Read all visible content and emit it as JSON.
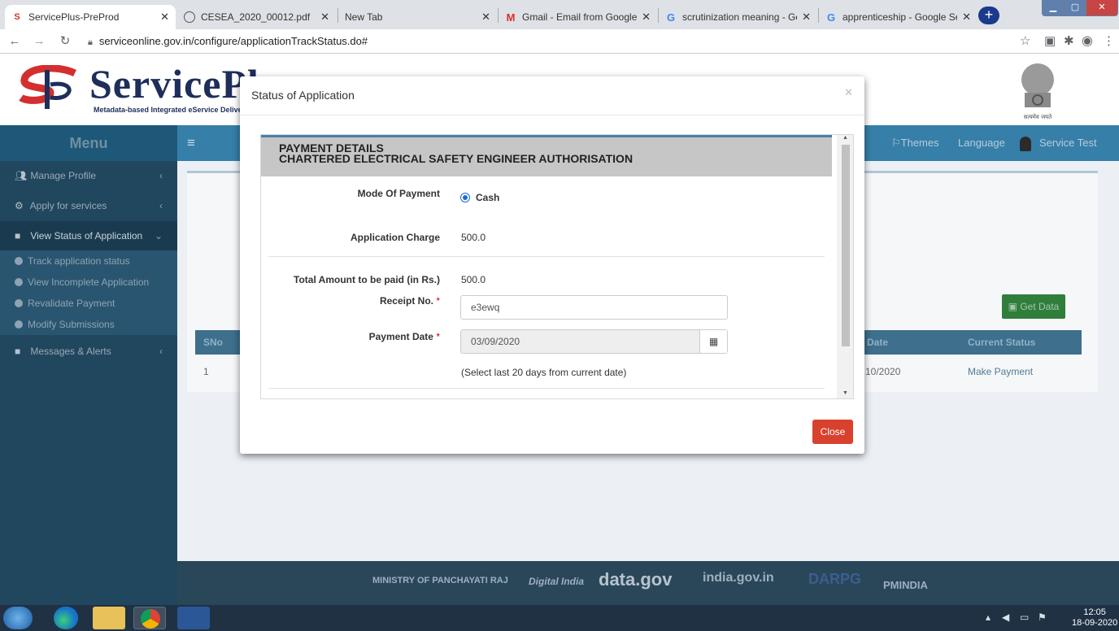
{
  "browser": {
    "tabs": [
      {
        "title": "ServicePlus-PreProd",
        "icon": "serviceplus-favicon"
      },
      {
        "title": "CESEA_2020_00012.pdf",
        "icon": "globe-icon"
      },
      {
        "title": "New Tab",
        "icon": ""
      },
      {
        "title": "Gmail - Email from Google",
        "icon": "gmail-icon"
      },
      {
        "title": "scrutinization meaning - Google",
        "icon": "google-icon"
      },
      {
        "title": "apprenticeship - Google Search",
        "icon": "google-icon"
      }
    ],
    "url": "serviceonline.gov.in/configure/applicationTrackStatus.do#"
  },
  "header": {
    "logo_text": "ServicePlus",
    "logo_sub": "Metadata-based Integrated eService Delivery",
    "emblem_caption": "सत्यमेव जयते"
  },
  "navbar": {
    "menu_label": "Menu",
    "themes_label": "Themes",
    "language_label": "Language",
    "user_label": "Service Test"
  },
  "sidebar": {
    "items": [
      {
        "label": "Manage Profile",
        "icon": "users-icon"
      },
      {
        "label": "Apply for services",
        "icon": "cogs-icon"
      },
      {
        "label": "View Status of Application",
        "icon": "list-icon"
      },
      {
        "label": "Messages & Alerts",
        "icon": "envelope-icon"
      }
    ],
    "subitems": [
      {
        "label": "Track application status"
      },
      {
        "label": "View Incomplete Application"
      },
      {
        "label": "Revalidate Payment"
      },
      {
        "label": "Modify Submissions"
      }
    ]
  },
  "table": {
    "get_data_label": "Get Data",
    "columns": {
      "sno": "SNo",
      "date": "Date",
      "status": "Current Status"
    },
    "rows": [
      {
        "sno": "1",
        "date": "10/2020",
        "status": "Make Payment"
      }
    ]
  },
  "modal": {
    "title": "Status of Application",
    "panel_line1": "PAYMENT DETAILS",
    "panel_line2": "CHARTERED ELECTRICAL SAFETY ENGINEER AUTHORISATION",
    "mode_label": "Mode Of Payment",
    "mode_value": "Cash",
    "charge_label": "Application Charge",
    "charge_value": "500.0",
    "total_label": "Total Amount to be paid (in Rs.)",
    "total_value": "500.0",
    "receipt_label": "Receipt No.",
    "receipt_value": "e3ewq",
    "date_label": "Payment Date",
    "date_value": "03/09/2020",
    "date_hint": "(Select last 20 days from current date)",
    "required_mark": "*",
    "close_label": "Close"
  },
  "footer": {
    "logos": [
      "MINISTRY OF PANCHAYATI RAJ",
      "Digital India",
      "data.gov",
      "india.gov.in",
      "DARPG",
      "PMINDIA"
    ]
  },
  "taskbar": {
    "time": "12:05",
    "date": "18-09-2020"
  },
  "colors": {
    "navbar": "#367fa9",
    "sidebar": "#21475f",
    "close_button": "#d9412f",
    "get_data": "#2f7e3c"
  }
}
